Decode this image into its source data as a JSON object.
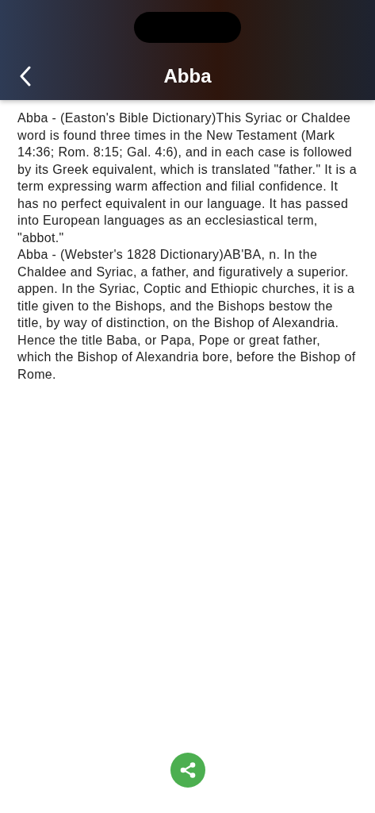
{
  "header": {
    "title": "Abba"
  },
  "paragraphs": [
    "Abba - (Easton's Bible Dictionary)This Syriac or Chaldee word is found three times in the New Testament (Mark 14:36; Rom. 8:15; Gal. 4:6), and in each case is followed by its Greek equivalent, which is translated \"father.\" It is a term expressing warm affection and filial confidence. It has no perfect equivalent in our language. It has passed into European languages as an ecclesiastical term, \"abbot.\"",
    "Abba - (Webster's 1828 Dictionary)AB'BA, n. In the Chaldee and Syriac, a father, and figuratively a superior. appen. In the Syriac, Coptic and Ethiopic churches, it is a title given to the Bishops, and the Bishops bestow the title, by way of distinction, on the Bishop of Alexandria. Hence the title Baba, or Papa, Pope or great father, which the Bishop of Alexandria bore, before the Bishop of Rome."
  ]
}
